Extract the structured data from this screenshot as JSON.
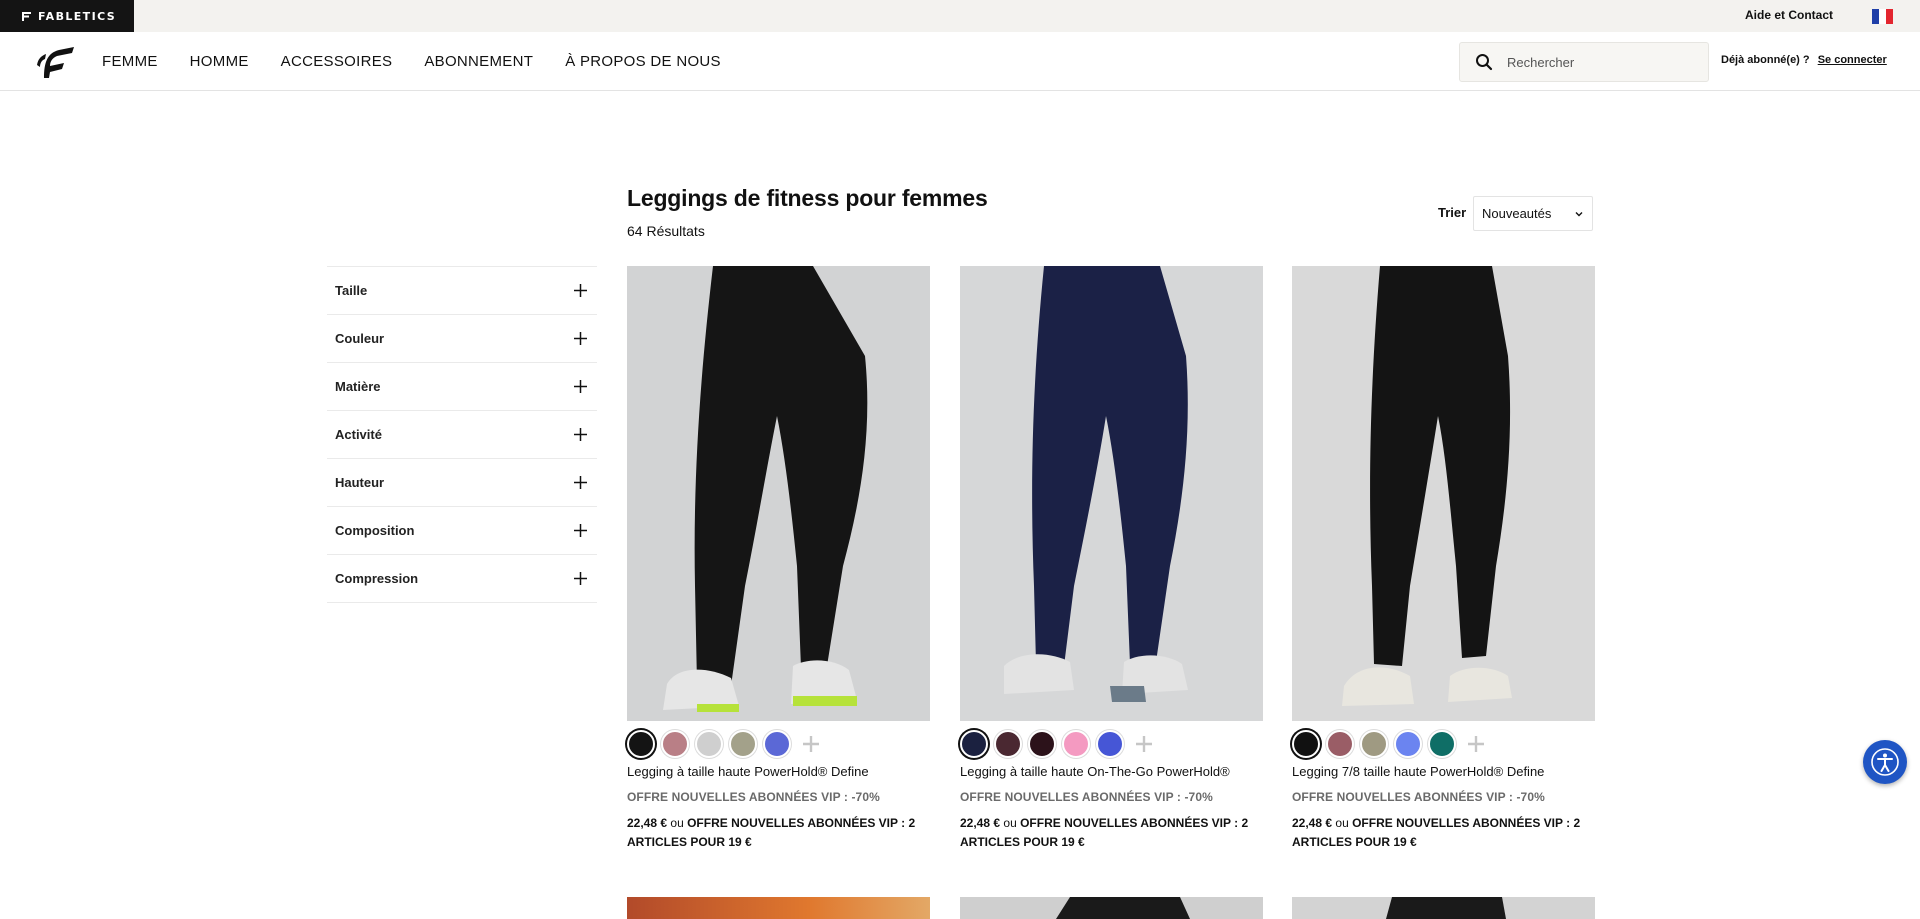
{
  "topbar": {
    "brand": "FABLETICS",
    "help_link": "Aide et Contact",
    "flag_icon": "france-flag-icon"
  },
  "nav": {
    "items": [
      "FEMME",
      "HOMME",
      "ACCESSOIRES",
      "ABONNEMENT",
      "À PROPOS DE NOUS"
    ],
    "search_placeholder": "Rechercher",
    "account_prompt": "Déjà abonné(e) ?",
    "login_link": "Se connecter"
  },
  "page": {
    "title": "Leggings de fitness pour femmes",
    "result_count": "64 Résultats",
    "sort_label": "Trier",
    "sort_value": "Nouveautés"
  },
  "filters": [
    "Taille",
    "Couleur",
    "Matière",
    "Activité",
    "Hauteur",
    "Composition",
    "Compression"
  ],
  "products": [
    {
      "name": "Legging à taille haute PowerHold® Define",
      "promo": "OFFRE NOUVELLES ABONNÉES VIP : -70%",
      "price": "22,48 €",
      "price_connector": "ou",
      "price_offer": "OFFRE NOUVELLES ABONNÉES VIP : 2 ARTICLES POUR 19 €",
      "swatches": [
        "#141414",
        "#b97f86",
        "#cfcfcf",
        "#a3a18a",
        "#5b68d6"
      ],
      "image_color": "#151515",
      "bg_color": "#d2d3d4"
    },
    {
      "name": "Legging à taille haute On-The-Go PowerHold®",
      "promo": "OFFRE NOUVELLES ABONNÉES VIP : -70%",
      "price": "22,48 €",
      "price_connector": "ou",
      "price_offer": "OFFRE NOUVELLES ABONNÉES VIP : 2 ARTICLES POUR 19 €",
      "swatches": [
        "#1b2140",
        "#4a2831",
        "#2c121a",
        "#f49ac1",
        "#4656d6"
      ],
      "image_color": "#1b2146",
      "bg_color": "#d6d7d8"
    },
    {
      "name": "Legging 7/8 taille haute PowerHold® Define",
      "promo": "OFFRE NOUVELLES ABONNÉES VIP : -70%",
      "price": "22,48 €",
      "price_connector": "ou",
      "price_offer": "OFFRE NOUVELLES ABONNÉES VIP : 2 ARTICLES POUR 19 €",
      "swatches": [
        "#111111",
        "#9a5d66",
        "#9f9a82",
        "#6b84f0",
        "#0f6e66"
      ],
      "image_color": "#141414",
      "bg_color": "#d9d9d9"
    }
  ],
  "colors": {
    "topbar_bg": "#f3f2ef",
    "brand_bg": "#141414",
    "a11y_button": "#1f55c4"
  }
}
